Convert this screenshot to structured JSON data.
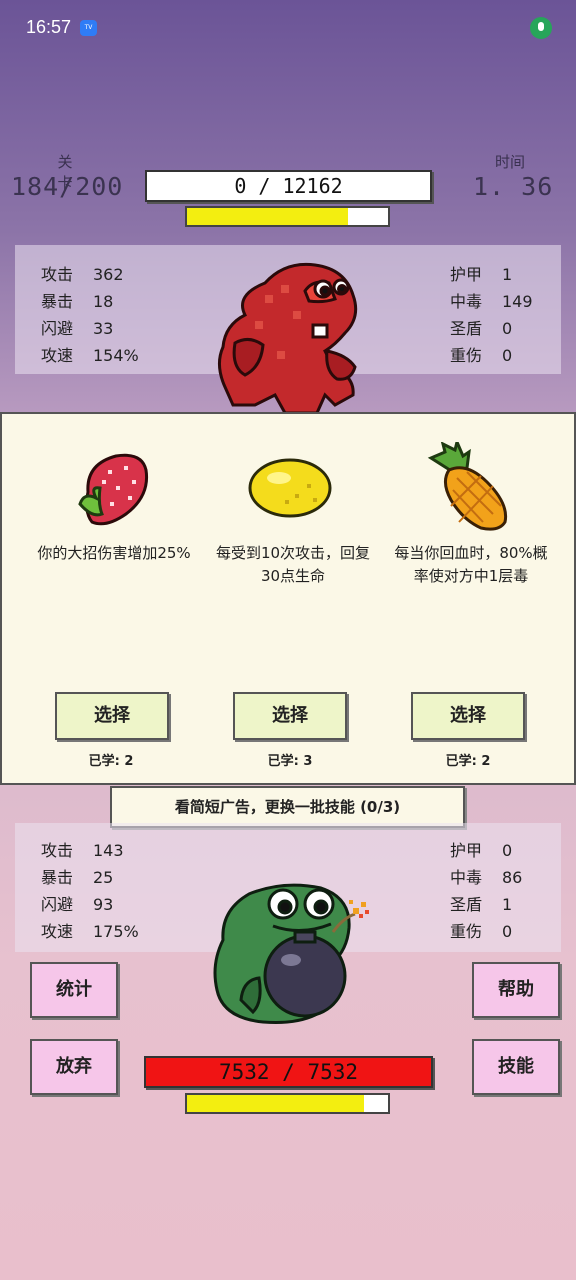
{
  "status_bar": {
    "time": "16:57",
    "badge": "TV"
  },
  "header": {
    "stage_label": "关卡",
    "stage_value": "184/200",
    "time_label": "时间",
    "time_value": "1. 36",
    "enemy_hp_text": "0  /  12162",
    "enemy_energy_fraction": 0.8
  },
  "enemy_stats": {
    "left": [
      {
        "label": "攻击",
        "value": "362"
      },
      {
        "label": "暴击",
        "value": "18"
      },
      {
        "label": "闪避",
        "value": "33"
      },
      {
        "label": "攻速",
        "value": "154%"
      }
    ],
    "right": [
      {
        "label": "护甲",
        "value": "1"
      },
      {
        "label": "中毒",
        "value": "149"
      },
      {
        "label": "圣盾",
        "value": "0"
      },
      {
        "label": "重伤",
        "value": "0"
      }
    ]
  },
  "skills": [
    {
      "icon": "strawberry-icon",
      "description": "你的大招伤害增加25%",
      "button": "选择",
      "learned": "已学: 2"
    },
    {
      "icon": "lemon-icon",
      "description": "每受到10次攻击，回复30点生命",
      "button": "选择",
      "learned": "已学: 3"
    },
    {
      "icon": "pineapple-icon",
      "description": "每当你回血时，80%概率使对方中1层毒",
      "button": "选择",
      "learned": "已学: 2"
    }
  ],
  "ad_banner": "看简短广告，更换一批技能 (0/3)",
  "player_stats": {
    "left": [
      {
        "label": "攻击",
        "value": "143"
      },
      {
        "label": "暴击",
        "value": "25"
      },
      {
        "label": "闪避",
        "value": "93"
      },
      {
        "label": "攻速",
        "value": "175%"
      }
    ],
    "right": [
      {
        "label": "护甲",
        "value": "0"
      },
      {
        "label": "中毒",
        "value": "86"
      },
      {
        "label": "圣盾",
        "value": "1"
      },
      {
        "label": "重伤",
        "value": "0"
      }
    ]
  },
  "buttons": {
    "stats": "统计",
    "give_up": "放弃",
    "help": "帮助",
    "skills": "技能"
  },
  "player": {
    "hp_text": "7532  /  7532",
    "energy_fraction": 0.88
  },
  "colors": {
    "hp_red": "#f01414",
    "energy_yellow": "#f3ee10",
    "button_pink": "#f6c6e9",
    "choose_green": "#eef5c9"
  }
}
